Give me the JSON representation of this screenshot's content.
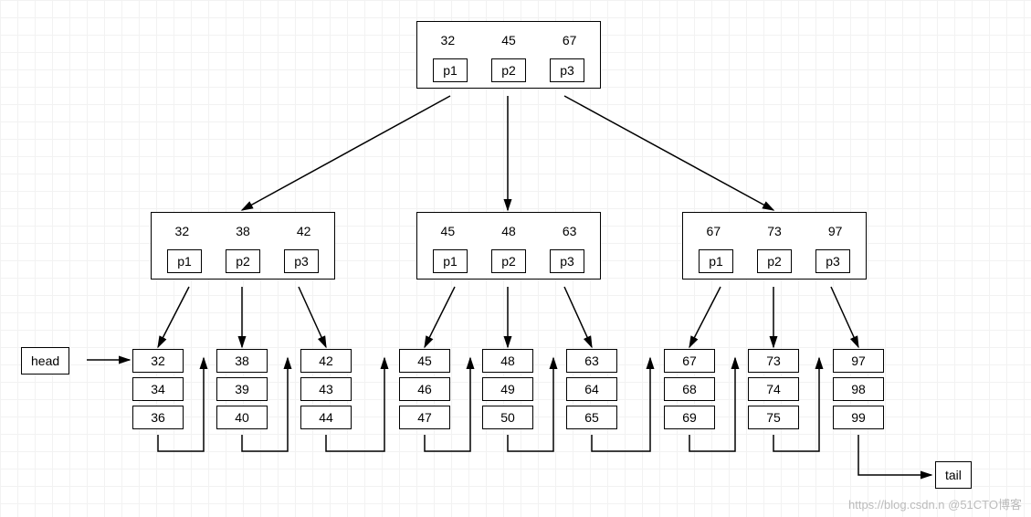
{
  "watermark": "https://blog.csdn.n  @51CTO博客",
  "labels": {
    "head": "head",
    "tail": "tail"
  },
  "pointers": {
    "p1": "p1",
    "p2": "p2",
    "p3": "p3"
  },
  "root": {
    "values": [
      "32",
      "45",
      "67"
    ]
  },
  "mid": [
    {
      "values": [
        "32",
        "38",
        "42"
      ]
    },
    {
      "values": [
        "45",
        "48",
        "63"
      ]
    },
    {
      "values": [
        "67",
        "73",
        "97"
      ]
    }
  ],
  "leaves": [
    [
      "32",
      "34",
      "36"
    ],
    [
      "38",
      "39",
      "40"
    ],
    [
      "42",
      "43",
      "44"
    ],
    [
      "45",
      "46",
      "47"
    ],
    [
      "48",
      "49",
      "50"
    ],
    [
      "63",
      "64",
      "65"
    ],
    [
      "67",
      "68",
      "69"
    ],
    [
      "73",
      "74",
      "75"
    ],
    [
      "97",
      "98",
      "99"
    ]
  ],
  "chart_data": {
    "type": "tree",
    "description": "B+ tree of order 3 (3 keys per node) with a doubly-linked leaf list from head to tail",
    "root": {
      "keys": [
        32,
        45,
        67
      ],
      "pointers": [
        "p1",
        "p2",
        "p3"
      ]
    },
    "internal_nodes": [
      {
        "keys": [
          32,
          38,
          42
        ],
        "pointers": [
          "p1",
          "p2",
          "p3"
        ]
      },
      {
        "keys": [
          45,
          48,
          63
        ],
        "pointers": [
          "p1",
          "p2",
          "p3"
        ]
      },
      {
        "keys": [
          67,
          73,
          97
        ],
        "pointers": [
          "p1",
          "p2",
          "p3"
        ]
      }
    ],
    "leaf_nodes": [
      [
        32,
        34,
        36
      ],
      [
        38,
        39,
        40
      ],
      [
        42,
        43,
        44
      ],
      [
        45,
        46,
        47
      ],
      [
        48,
        49,
        50
      ],
      [
        63,
        64,
        65
      ],
      [
        67,
        68,
        69
      ],
      [
        73,
        74,
        75
      ],
      [
        97,
        98,
        99
      ]
    ],
    "leaf_linked_list": [
      "head",
      0,
      1,
      2,
      3,
      4,
      5,
      6,
      7,
      8,
      "tail"
    ]
  }
}
